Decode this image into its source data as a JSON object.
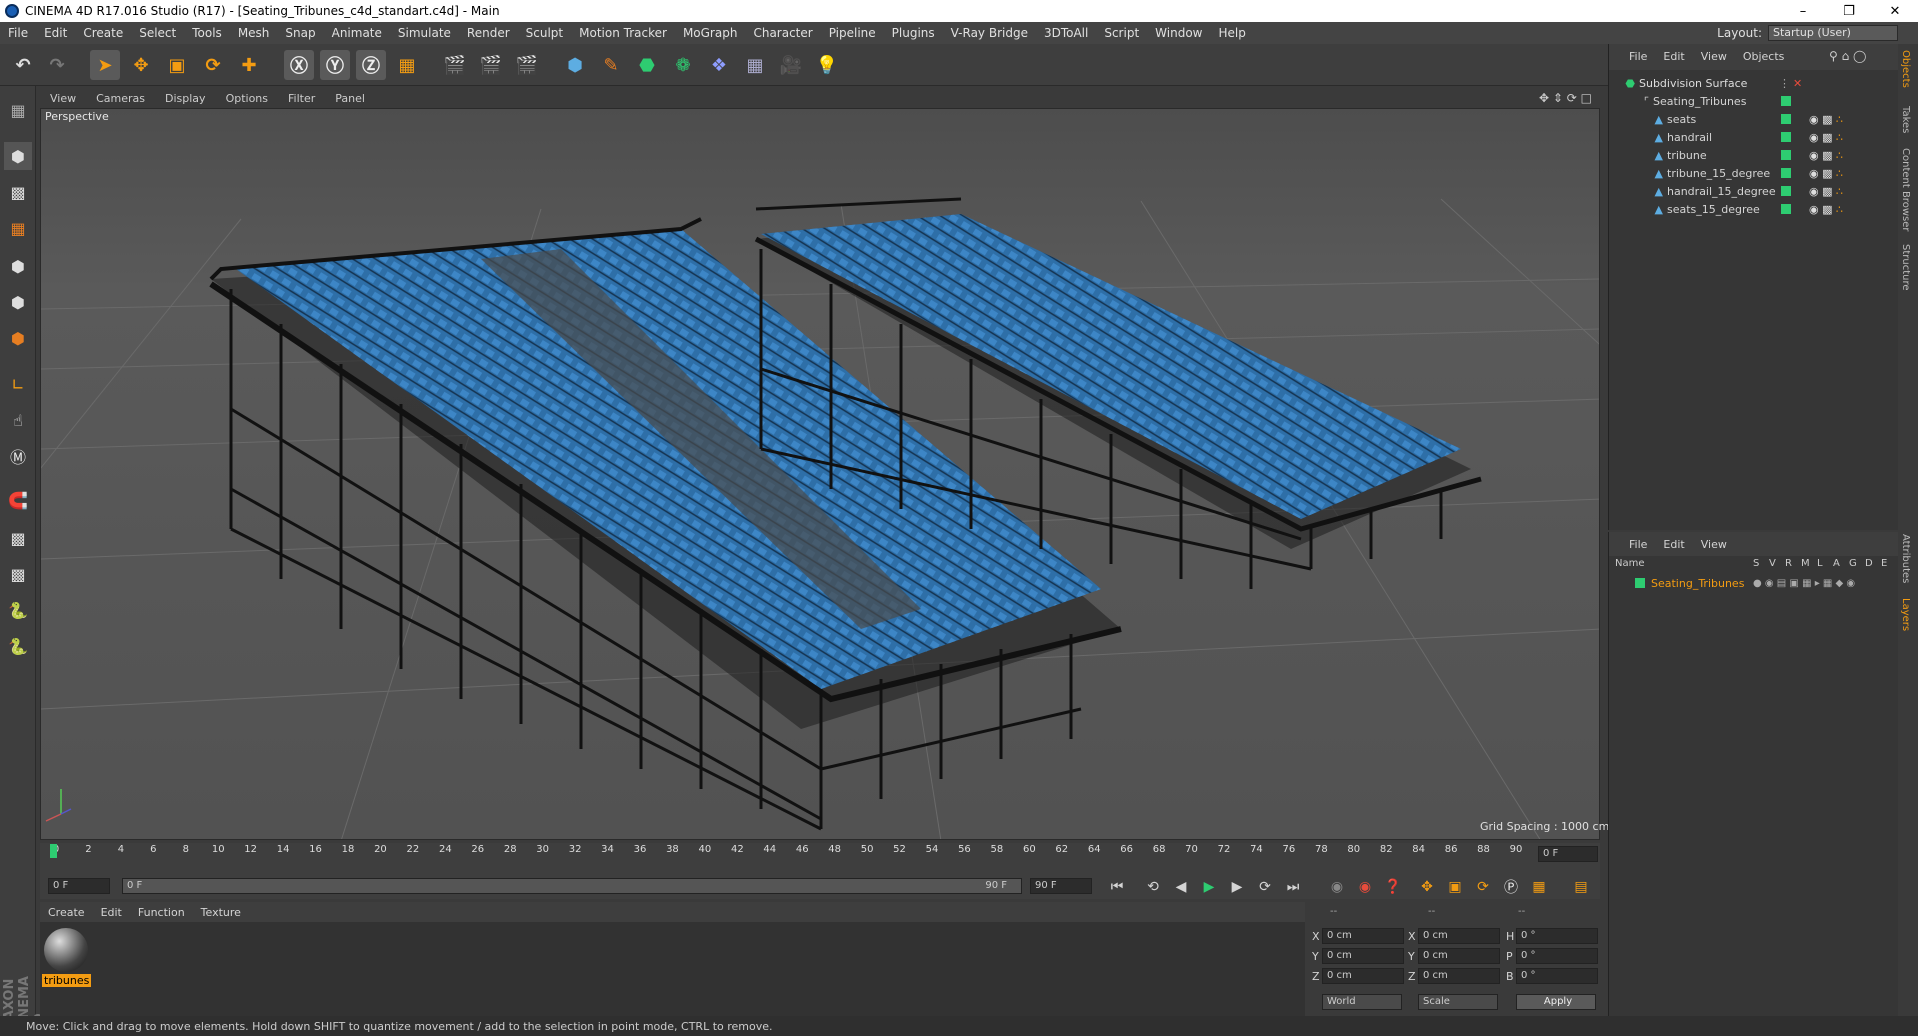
{
  "window": {
    "title": "CINEMA 4D R17.016 Studio (R17) - [Seating_Tribunes_c4d_standart.c4d] - Main"
  },
  "menubar": {
    "items": [
      "File",
      "Edit",
      "Create",
      "Select",
      "Tools",
      "Mesh",
      "Snap",
      "Animate",
      "Simulate",
      "Render",
      "Sculpt",
      "Motion Tracker",
      "MoGraph",
      "Character",
      "Pipeline",
      "Plugins",
      "V-Ray Bridge",
      "3DToAll",
      "Script",
      "Window",
      "Help"
    ],
    "layout_label": "Layout:",
    "layout_value": "Startup (User)"
  },
  "viewport": {
    "menu": [
      "View",
      "Cameras",
      "Display",
      "Options",
      "Filter",
      "Panel"
    ],
    "camera_label": "Perspective",
    "grid_spacing": "Grid Spacing : 1000 cm"
  },
  "timeline": {
    "ticks": [
      "0",
      "2",
      "4",
      "6",
      "8",
      "10",
      "12",
      "14",
      "16",
      "18",
      "20",
      "22",
      "24",
      "26",
      "28",
      "30",
      "32",
      "34",
      "36",
      "38",
      "40",
      "42",
      "44",
      "46",
      "48",
      "50",
      "52",
      "54",
      "56",
      "58",
      "60",
      "62",
      "64",
      "66",
      "68",
      "70",
      "72",
      "74",
      "76",
      "78",
      "80",
      "82",
      "84",
      "86",
      "88",
      "90"
    ],
    "current_frame": "0 F",
    "start_field": "0 F",
    "range_start": "0 F",
    "range_end": "90 F",
    "end_field": "90 F"
  },
  "materials": {
    "menu": [
      "Create",
      "Edit",
      "Function",
      "Texture"
    ],
    "items": [
      {
        "name": "tribunes"
      }
    ]
  },
  "coords": {
    "header": [
      "--",
      "--",
      "--"
    ],
    "rows": [
      {
        "a": "X",
        "av": "0 cm",
        "b": "X",
        "bv": "0 cm",
        "c": "H",
        "cv": "0 °"
      },
      {
        "a": "Y",
        "av": "0 cm",
        "b": "Y",
        "bv": "0 cm",
        "c": "P",
        "cv": "0 °"
      },
      {
        "a": "Z",
        "av": "0 cm",
        "b": "Z",
        "bv": "0 cm",
        "c": "B",
        "cv": "0 °"
      }
    ],
    "world": "World",
    "scale": "Scale",
    "apply": "Apply"
  },
  "objects": {
    "menu": [
      "File",
      "Edit",
      "View",
      "Objects"
    ],
    "tree": [
      {
        "name": "Subdivision Surface",
        "level": 0
      },
      {
        "name": "Seating_Tribunes",
        "level": 1
      },
      {
        "name": "seats",
        "level": 2
      },
      {
        "name": "handrail",
        "level": 2
      },
      {
        "name": "tribune",
        "level": 2
      },
      {
        "name": "tribune_15_degree",
        "level": 2
      },
      {
        "name": "handrail_15_degree",
        "level": 2
      },
      {
        "name": "seats_15_degree",
        "level": 2
      }
    ]
  },
  "layers": {
    "menu": [
      "File",
      "Edit",
      "View"
    ],
    "columns": [
      "Name",
      "S",
      "V",
      "R",
      "M",
      "L",
      "A",
      "G",
      "D",
      "E"
    ],
    "rows": [
      {
        "name": "Seating_Tribunes"
      }
    ]
  },
  "side_tabs": [
    "Objects",
    "Takes",
    "Content Browser",
    "Structure",
    "Attributes",
    "Layers"
  ],
  "status": "Move: Click and drag to move elements. Hold down SHIFT to quantize movement / add to the selection in point mode, CTRL to remove.",
  "brand": "MAXON CINEMA 4D",
  "colors": {
    "accent": "#f39c12",
    "tag_green": "#2ecc71",
    "seat_blue": "#2e6fa8"
  }
}
